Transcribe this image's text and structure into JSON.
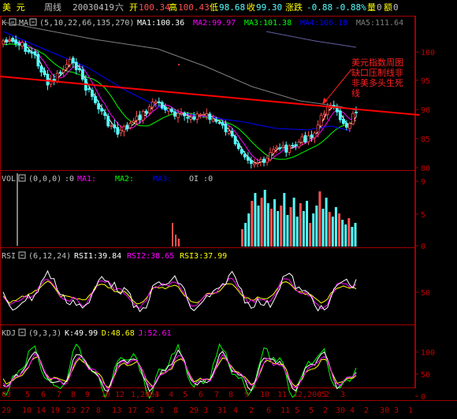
{
  "header": {
    "symbol": "美    元",
    "period": "周线",
    "date": "20030419",
    "weekday": "六",
    "open_label": "开",
    "open": "100.34",
    "high_label": "高",
    "high": "100.43",
    "low_label": "低",
    "low": "98.68",
    "close_label": "收",
    "close": "99.30",
    "change_label": "涨跌",
    "change": "-0.88",
    "change_pct": "-0.88%",
    "volume_label": "量",
    "volume": "0",
    "amount_label": "额",
    "amount": "0"
  },
  "main_panel": {
    "k_label": "K",
    "ma_label": "MA",
    "ma_params": "(5,10,22,66,135,270)",
    "ma_values": [
      {
        "name": "MA1",
        "value": "100.36",
        "color": "#ffffff"
      },
      {
        "name": "MA2",
        "value": "99.97",
        "color": "#ff00ff"
      },
      {
        "name": "MA3",
        "value": "101.38",
        "color": "#00ff00"
      },
      {
        "name": "MA4",
        "value": "106.18",
        "color": "#0000ff"
      },
      {
        "name": "MA5",
        "value": "111.64",
        "color": "#808080"
      }
    ],
    "y_ticks": [
      "100",
      "95",
      "90",
      "85",
      "80"
    ],
    "annotation": [
      "美元指数周图",
      "缺口压制线非",
      "非美多头生死",
      "线"
    ]
  },
  "vol_panel": {
    "label": "VOL",
    "params": "(0,0,0)",
    "value": ":0",
    "ma_labels": [
      "MA1:",
      "MA2:",
      "MA3:",
      "OI :0"
    ],
    "y_ticks": [
      "9",
      "5",
      "0"
    ]
  },
  "rsi_panel": {
    "label": "RSI",
    "params": "(6,12,24)",
    "values": [
      {
        "name": "RSI1",
        "value": "39.84",
        "color": "#ffffff"
      },
      {
        "name": "RSI2",
        "value": "38.65",
        "color": "#ff00ff"
      },
      {
        "name": "RSI3",
        "value": "37.99",
        "color": "#ffff00"
      }
    ],
    "y_ticks": [
      "50"
    ]
  },
  "kdj_panel": {
    "label": "KDJ",
    "params": "(9,3,3)",
    "values": [
      {
        "name": "K",
        "value": "49.99",
        "color": "#ffffff"
      },
      {
        "name": "D",
        "value": "48.68",
        "color": "#ffff00"
      },
      {
        "name": "J",
        "value": "52.61",
        "color": "#ff00ff"
      }
    ],
    "y_ticks": [
      "100",
      "50",
      "0"
    ]
  },
  "x_axis": {
    "row1": [
      "03",
      "5",
      "6",
      "7",
      "8",
      "9",
      "10",
      "12",
      "1,2004",
      "3",
      "4",
      "5",
      "6",
      "7",
      "8",
      "9",
      "10",
      "11",
      "12,2005",
      "2",
      "3",
      "4",
      "5",
      "6",
      "7",
      "8",
      "9",
      "10"
    ],
    "row2": [
      "29",
      "10",
      "14",
      "19",
      "23",
      "27",
      "8",
      "13",
      "17",
      "26",
      "1",
      "8",
      "29",
      "3",
      "31",
      "4",
      "2",
      "6",
      "11",
      "5",
      "5",
      "2",
      "30",
      "4",
      "2",
      "30",
      "3",
      "1"
    ]
  },
  "colors": {
    "background": "#000000",
    "frame": "#a00000",
    "up_candle": "#ff5050",
    "down_candle": "#54ffff",
    "ma1": "#ffffff",
    "ma2": "#ff00ff",
    "ma3": "#00ff00",
    "ma4": "#0000ff",
    "ma5": "#808080",
    "trendline": "#ff0000",
    "axis_text": "#c00000"
  }
}
